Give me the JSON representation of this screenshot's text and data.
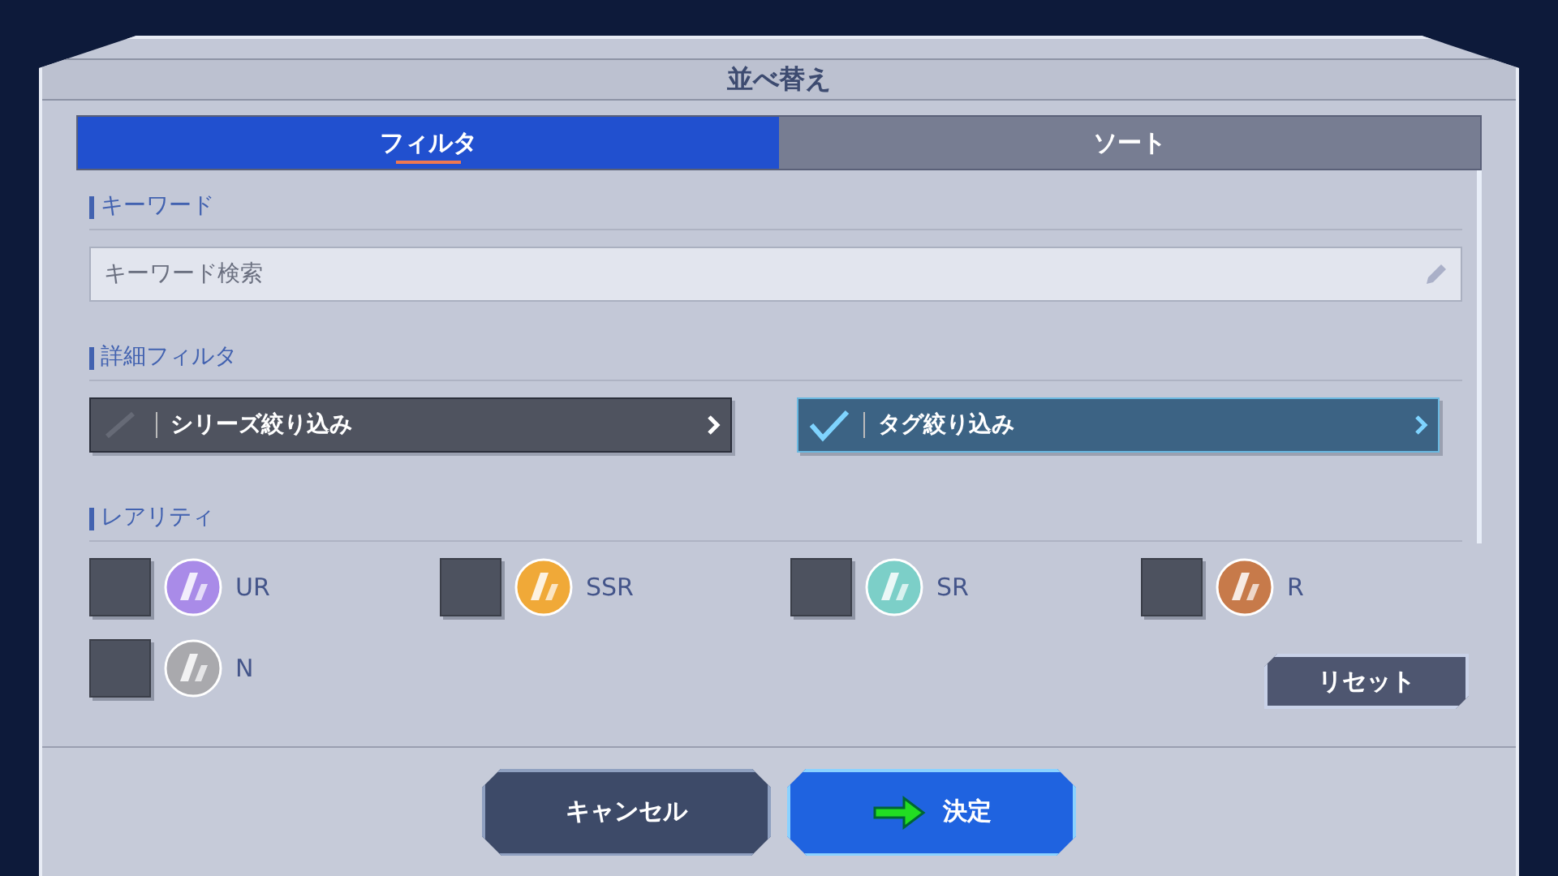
{
  "title": "並べ替え",
  "tabs": [
    {
      "label": "フィルタ",
      "selected": true
    },
    {
      "label": "ソート",
      "selected": false
    }
  ],
  "keyword": {
    "heading": "キーワード",
    "placeholder": "キーワード検索"
  },
  "detail_filter": {
    "heading": "詳細フィルタ",
    "buttons": [
      {
        "label": "シリーズ絞り込み",
        "checked": false
      },
      {
        "label": "タグ絞り込み",
        "checked": true
      }
    ]
  },
  "rarity": {
    "heading": "レアリティ",
    "items": [
      {
        "label": "UR",
        "checked": false,
        "color": "#a98be8"
      },
      {
        "label": "SSR",
        "checked": false,
        "color": "#f0a938"
      },
      {
        "label": "SR",
        "checked": false,
        "color": "#7ccfc8"
      },
      {
        "label": "R",
        "checked": false,
        "color": "#c77a4a"
      },
      {
        "label": "N",
        "checked": false,
        "color": "#a9a9ad"
      }
    ],
    "reset": "リセット"
  },
  "footer_buttons": [
    {
      "label": "キャンセル",
      "kind": "cancel",
      "pointer": false
    },
    {
      "label": "決定",
      "kind": "confirm",
      "pointer": true
    }
  ]
}
